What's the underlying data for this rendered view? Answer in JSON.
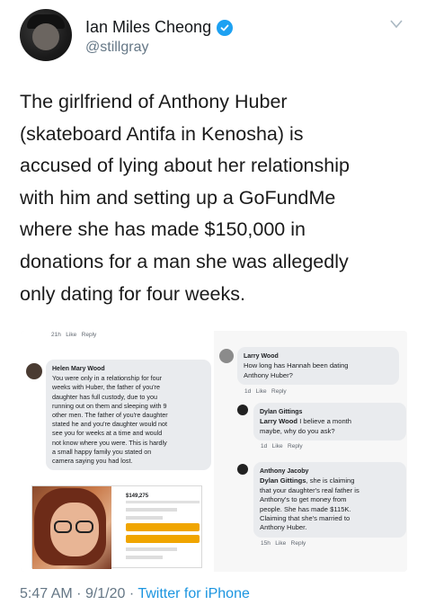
{
  "user": {
    "display_name": "Ian Miles Cheong",
    "handle": "@stillgray",
    "verified": true
  },
  "tweet": {
    "lines": [
      "The girlfriend of Anthony Huber",
      "(skateboard Antifa in Kenosha) is",
      "accused of lying about her relationship",
      "with him and setting up a GoFundMe",
      "where she has made $150,000 in",
      "donations for a man she was allegedly",
      "only dating for four weeks."
    ],
    "time": "5:47 AM",
    "date": "9/1/20",
    "separator": "·",
    "source": "Twitter for iPhone"
  },
  "media": {
    "left": {
      "top_meta": {
        "time": "21h",
        "like": "Like",
        "reply": "Reply"
      },
      "comment": {
        "author": "Helen Mary Wood",
        "lines": [
          "You were only in a relationship for four",
          "weeks with Huber, the father of you're",
          "daughter has full custody, due to you",
          "running out on them and sleeping with 9",
          "other men. The father of you're daughter",
          "stated he and you're daughter would not",
          "see you for weeks at a time and would",
          "not know where you were. This is hardly",
          "a small happy family you stated on",
          "camera saying you had lost."
        ]
      },
      "gofundme_amount": "$149,275"
    },
    "right": {
      "comments": [
        {
          "author": "Larry Wood",
          "lines": [
            "How long has Hannah been dating",
            "Anthony Huber?"
          ],
          "time": "1d",
          "like": "Like",
          "reply": "Reply"
        },
        {
          "author": "Dylan Gittings",
          "mention": "Larry Wood",
          "lines": [
            "I believe a month",
            "maybe, why do you ask?"
          ],
          "time": "1d",
          "like": "Like",
          "reply": "Reply"
        },
        {
          "author": "Anthony Jacoby",
          "mention": "Dylan Gittings",
          "lines": [
            ", she is claiming",
            "that your daughter's real father is",
            "Anthony's to get money from",
            "people. She has made $115K.",
            "Claiming that she's married to",
            "Anthony Huber."
          ],
          "time": "15h",
          "like": "Like",
          "reply": "Reply"
        }
      ]
    }
  },
  "colors": {
    "verified": "#1da1f2",
    "link": "#1b95e0",
    "muted": "#657786"
  }
}
